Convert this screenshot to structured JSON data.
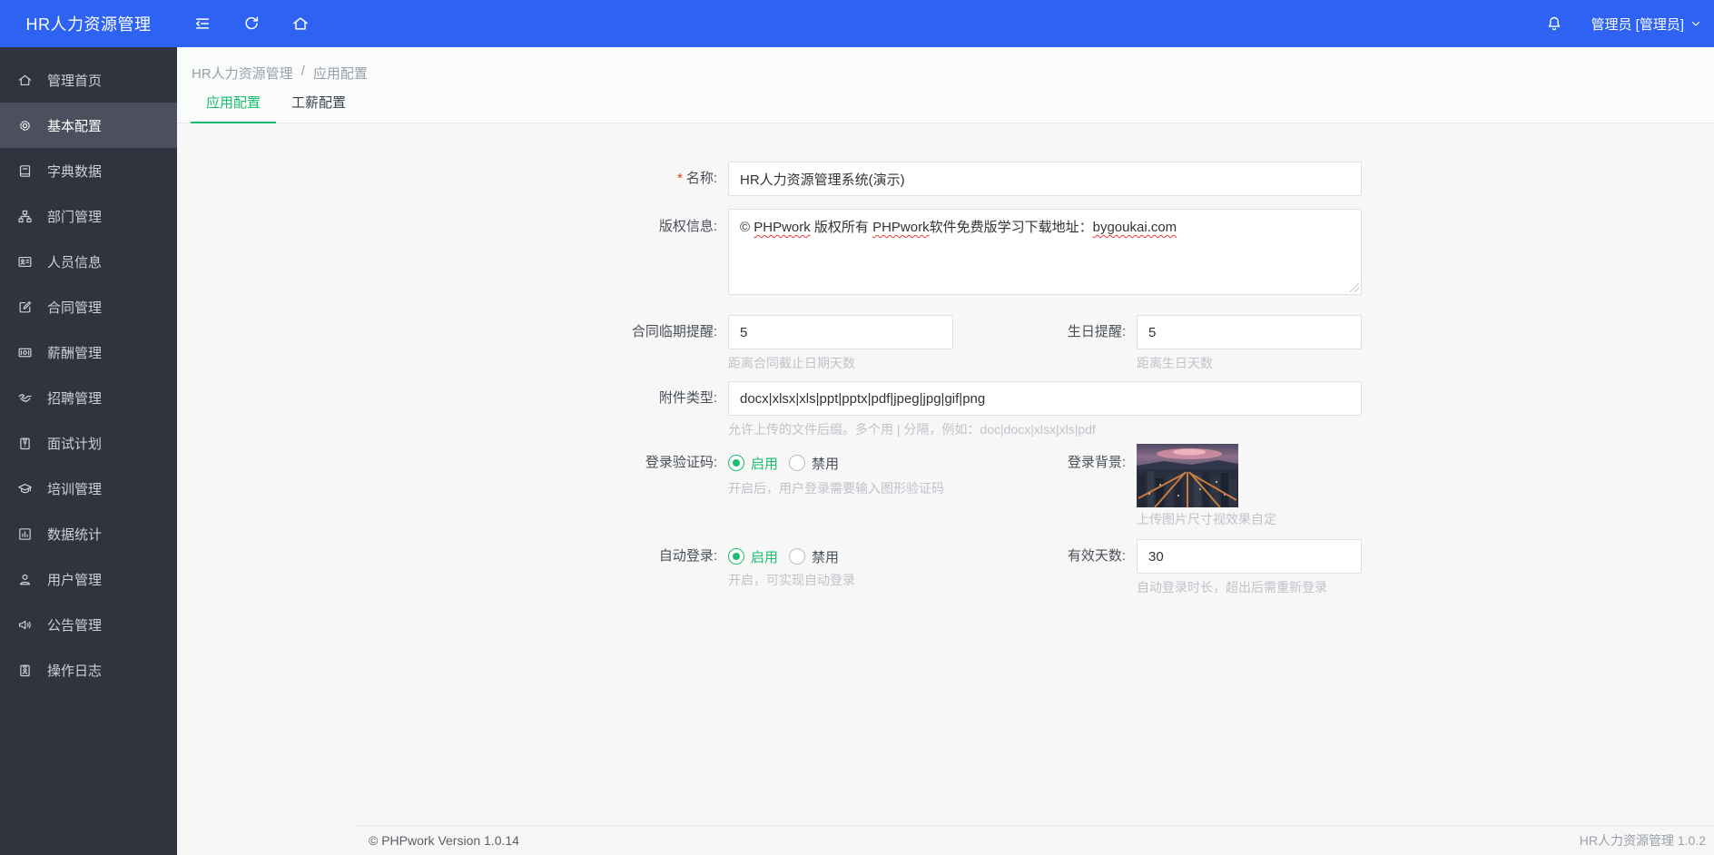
{
  "topbar": {
    "brand": "HR人力资源管理",
    "user_label": "管理员 [管理员]"
  },
  "sidebar": {
    "items": [
      {
        "label": "管理首页",
        "icon": "home-icon",
        "active": false
      },
      {
        "label": "基本配置",
        "icon": "gear-icon",
        "active": true
      },
      {
        "label": "字典数据",
        "icon": "book-icon",
        "active": false
      },
      {
        "label": "部门管理",
        "icon": "sitemap-icon",
        "active": false
      },
      {
        "label": "人员信息",
        "icon": "id-card-icon",
        "active": false
      },
      {
        "label": "合同管理",
        "icon": "contract-pen-icon",
        "active": false
      },
      {
        "label": "薪酬管理",
        "icon": "salary-cash-icon",
        "active": false
      },
      {
        "label": "招聘管理",
        "icon": "handshake-icon",
        "active": false
      },
      {
        "label": "面试计划",
        "icon": "interview-clipboard-icon",
        "active": false
      },
      {
        "label": "培训管理",
        "icon": "graduation-cap-icon",
        "active": false
      },
      {
        "label": "数据统计",
        "icon": "bar-chart-icon",
        "active": false
      },
      {
        "label": "用户管理",
        "icon": "user-icon",
        "active": false
      },
      {
        "label": "公告管理",
        "icon": "speaker-icon",
        "active": false
      },
      {
        "label": "操作日志",
        "icon": "log-clipboard-icon",
        "active": false
      }
    ]
  },
  "breadcrumb": {
    "root": "HR人力资源管理",
    "separator": "/",
    "current": "应用配置"
  },
  "tabs": [
    {
      "label": "应用配置",
      "active": true
    },
    {
      "label": "工薪配置",
      "active": false
    }
  ],
  "form": {
    "name": {
      "label": "名称:",
      "required_mark": "*",
      "value": "HR人力资源管理系统(演示)"
    },
    "copyright": {
      "label": "版权信息:",
      "segments": [
        {
          "text": "© ",
          "wavy": false
        },
        {
          "text": "PHPwork",
          "wavy": true
        },
        {
          "text": " 版权所有 ",
          "wavy": false
        },
        {
          "text": "PHPwork",
          "wavy": true
        },
        {
          "text": "软件免费版学习下载地址：",
          "wavy": false
        },
        {
          "text": "bygoukai.com",
          "wavy": true
        }
      ]
    },
    "contract_reminder": {
      "label": "合同临期提醒:",
      "value": "5",
      "hint": "距离合同截止日期天数"
    },
    "birthday_reminder": {
      "label": "生日提醒:",
      "value": "5",
      "hint": "距离生日天数"
    },
    "attachment_type": {
      "label": "附件类型:",
      "value": "docx|xlsx|xls|ppt|pptx|pdf|jpeg|jpg|gif|png",
      "hint": "允许上传的文件后缀。多个用 | 分隔，例如：doc|docx|xlsx|xls|pdf"
    },
    "login_captcha": {
      "label": "登录验证码:",
      "options": [
        {
          "label": "启用",
          "selected": true
        },
        {
          "label": "禁用",
          "selected": false
        }
      ],
      "hint": "开启后，用户登录需要输入图形验证码"
    },
    "login_background": {
      "label": "登录背景:",
      "image": "city-skyline-at-dusk-thumbnail",
      "hint": "上传图片尺寸视效果自定"
    },
    "auto_login": {
      "label": "自动登录:",
      "options": [
        {
          "label": "启用",
          "selected": true
        },
        {
          "label": "禁用",
          "selected": false
        }
      ],
      "hint": "开启，可实现自动登录"
    },
    "valid_days": {
      "label": "有效天数:",
      "value": "30",
      "hint": "自动登录时长，超出后需重新登录"
    }
  },
  "footer": {
    "left": "© PHPwork Version 1.0.14",
    "right": "HR人力资源管理 1.0.2"
  },
  "colors": {
    "topbar_blue": "#2d62f2",
    "sidebar_dark": "#2f343e",
    "sidebar_active": "#4b4f5e",
    "accent_green": "#1abd6d",
    "required_red": "#ed4014",
    "hint_gray": "#bfc3c9"
  }
}
